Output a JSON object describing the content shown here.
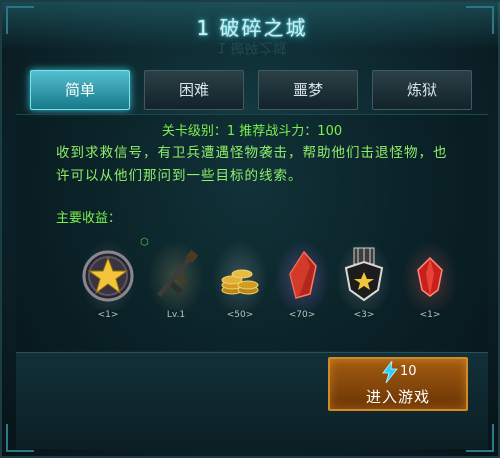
{
  "title": "1 破碎之城",
  "tabs": [
    {
      "label": "简单",
      "active": true
    },
    {
      "label": "困难",
      "active": false
    },
    {
      "label": "噩梦",
      "active": false
    },
    {
      "label": "炼狱",
      "active": false
    }
  ],
  "stage": {
    "level_line": "关卡级别：1  推荐战斗力：100",
    "description": "收到求救信号，有卫兵遭遇怪物袭击，帮助他们击退怪物，也许可以从他们那问到一些目标的线索。",
    "rewards_label": "主要收益："
  },
  "rewards": [
    {
      "icon": "star-medal-icon",
      "count": "<1>"
    },
    {
      "icon": "rifle-icon",
      "count": "Lv.1"
    },
    {
      "icon": "gold-coins-icon",
      "count": "<50>"
    },
    {
      "icon": "red-crystal-icon",
      "count": "<70>"
    },
    {
      "icon": "rank-badge-icon",
      "count": "<3>"
    },
    {
      "icon": "ruby-gem-icon",
      "count": "<1>"
    }
  ],
  "start_button": {
    "label": "进入游戏",
    "energy_cost": "10",
    "energy_icon": "lightning-icon"
  },
  "colors": {
    "active_tab": "#36c6d6",
    "highlight_text": "#7cf04e",
    "button": "#a35c11"
  }
}
